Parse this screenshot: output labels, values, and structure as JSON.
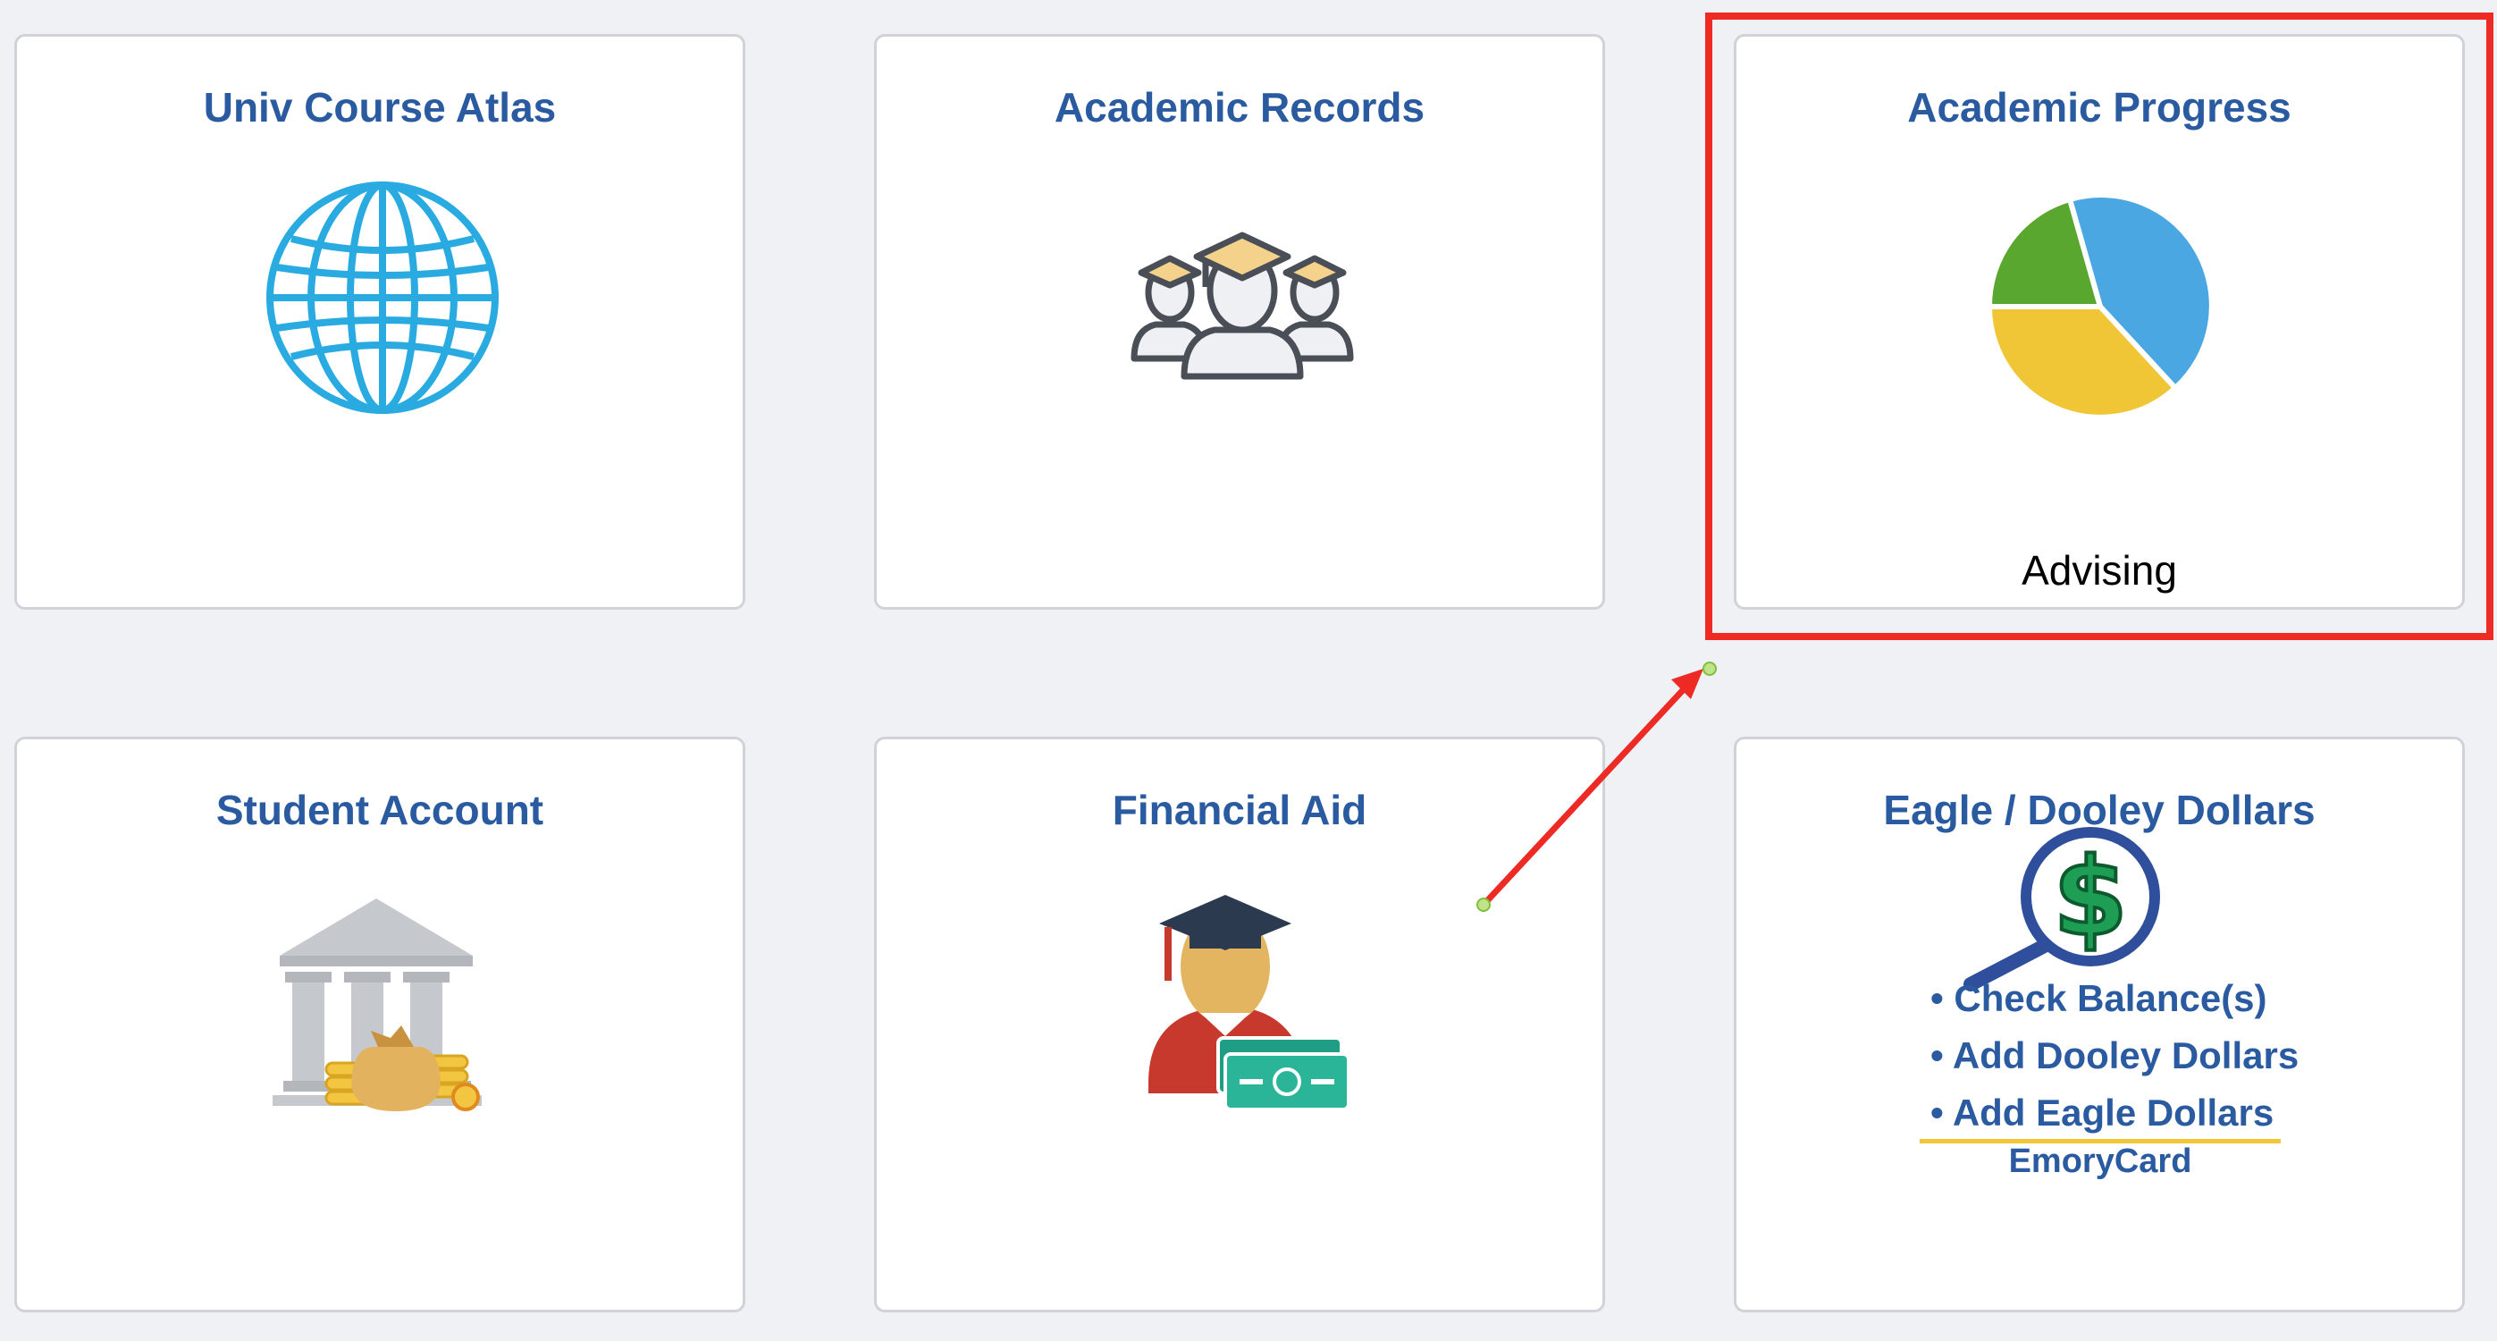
{
  "tiles": {
    "course_atlas": {
      "title": "Univ Course Atlas"
    },
    "academic_records": {
      "title": "Academic Records"
    },
    "academic_progress": {
      "title": "Academic Progress",
      "subtitle": "Advising"
    },
    "student_account": {
      "title": "Student Account"
    },
    "financial_aid": {
      "title": "Financial Aid"
    },
    "eagle_dooley": {
      "title": "Eagle / Dooley Dollars",
      "links": [
        "• Check Balance(s)",
        "• Add Dooley Dollars",
        "• Add Eagle Dollars"
      ],
      "footer": "EmoryCard"
    }
  },
  "colors": {
    "background": "#eff1f5",
    "tile_title": "#2a5aa0",
    "highlight": "#ee2a24",
    "globe": "#29abe2",
    "pie_blue": "#4aa7e2",
    "pie_yellow": "#f0c637",
    "pie_green": "#5aa72f"
  },
  "icons": {
    "course_atlas": "globe-icon",
    "academic_records": "graduates-icon",
    "academic_progress": "pie-chart-icon",
    "student_account": "bank-icon",
    "financial_aid": "student-money-icon",
    "eagle_dooley": "dollar-magnifier-icon"
  }
}
